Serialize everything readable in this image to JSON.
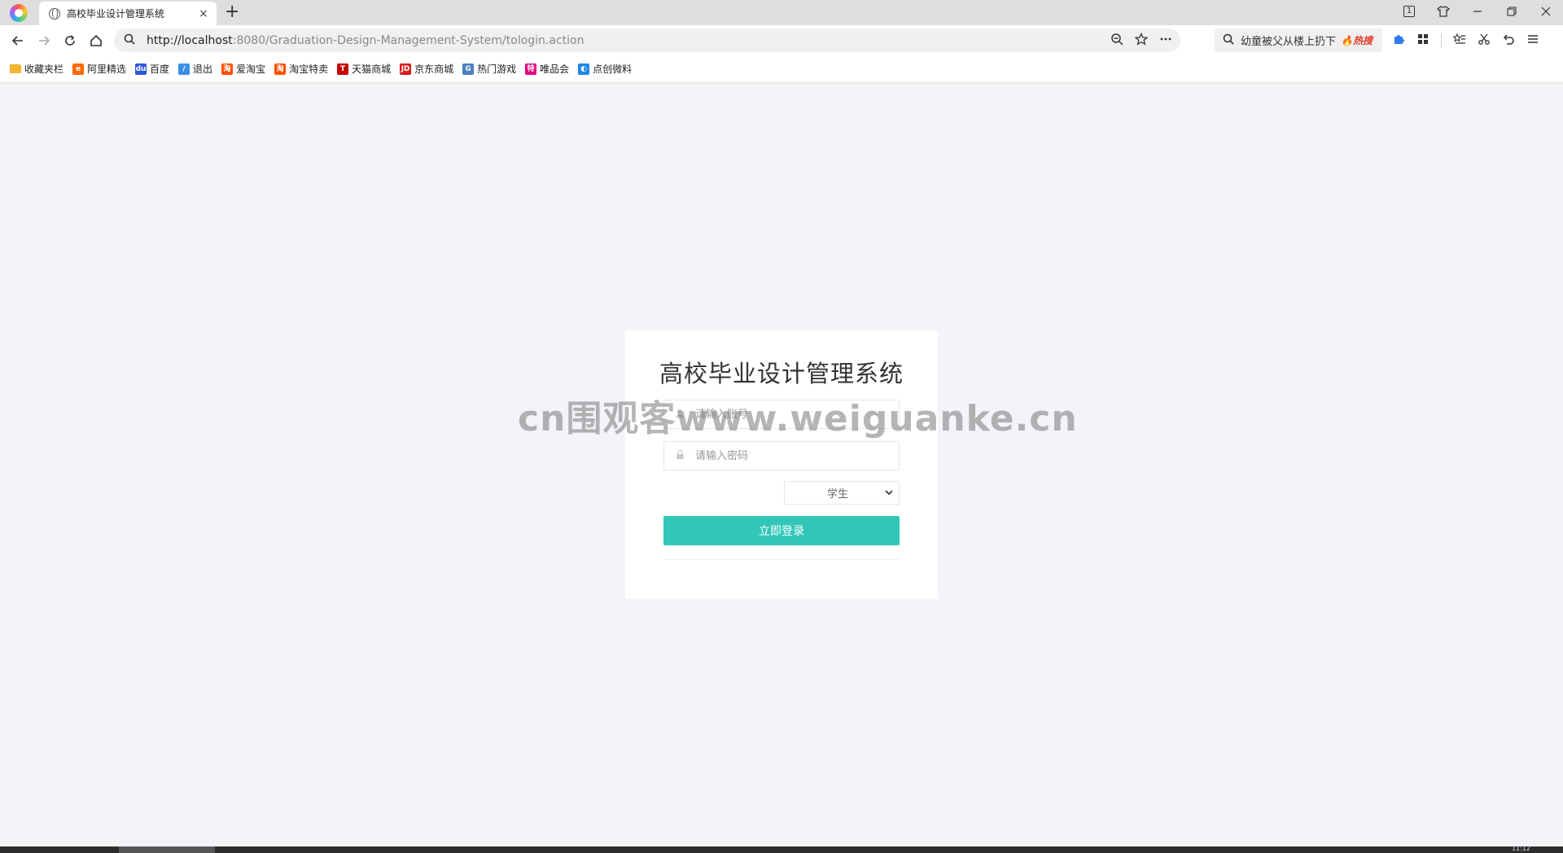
{
  "browser": {
    "tab_title": "高校毕业设计管理系统",
    "tab_close": "×",
    "new_tab": "+",
    "tab_count": "1",
    "url_host": "http://localhost",
    "url_path": ":8080/Graduation-Design-Management-System/tologin.action",
    "hot_search_text": "幼童被父从楼上扔下",
    "hot_search_tag": "热搜"
  },
  "bookmarks": [
    {
      "label": "收藏夹栏",
      "icon": "folder-icon",
      "color": "#f2b531",
      "glyph": ""
    },
    {
      "label": "阿里精选",
      "icon": "alibaba-icon",
      "color": "#ff6a00",
      "glyph": "e"
    },
    {
      "label": "百度",
      "icon": "baidu-icon",
      "color": "#2b57d8",
      "glyph": "du"
    },
    {
      "label": "退出",
      "icon": "feather-icon",
      "color": "#3a8ee6",
      "glyph": "/"
    },
    {
      "label": "爱淘宝",
      "icon": "taobao-icon",
      "color": "#ff5000",
      "glyph": "淘"
    },
    {
      "label": "淘宝特卖",
      "icon": "taobao-sale-icon",
      "color": "#ff5000",
      "glyph": "淘"
    },
    {
      "label": "天猫商城",
      "icon": "tmall-icon",
      "color": "#c40000",
      "glyph": "T"
    },
    {
      "label": "京东商城",
      "icon": "jd-icon",
      "color": "#d71c1e",
      "glyph": "JD"
    },
    {
      "label": "热门游戏",
      "icon": "game-icon",
      "color": "#4a7fc1",
      "glyph": "G"
    },
    {
      "label": "唯品会",
      "icon": "vip-icon",
      "color": "#e4007f",
      "glyph": "特"
    },
    {
      "label": "点创微料",
      "icon": "dianchuang-icon",
      "color": "#1e88e5",
      "glyph": "◐"
    }
  ],
  "login": {
    "title": "高校毕业设计管理系统",
    "username_placeholder": "请输入账号",
    "password_placeholder": "请输入密码",
    "role_selected": "学生",
    "submit_label": "立即登录"
  },
  "watermark": "cn围观客www.weiguanke.cn",
  "taskbar_clock": "11:12",
  "colors": {
    "accent": "#32c6b8",
    "page_bg": "#f3f4f8"
  }
}
